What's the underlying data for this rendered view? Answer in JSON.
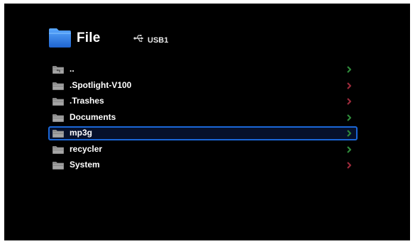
{
  "header": {
    "title": "File",
    "folder_icon": "folder-icon",
    "usb_icon": "usb-icon",
    "device_label": "USB1"
  },
  "colors": {
    "background": "#000000",
    "folder_blue": "#2f7fe6",
    "selection_border": "#1b67d8",
    "arrow_green": "#2f8a3a",
    "arrow_red": "#9a2a3a"
  },
  "files": [
    {
      "name": "..",
      "icon": "parent-folder-icon",
      "arrow_color": "green",
      "selected": false
    },
    {
      "name": ".Spotlight-V100",
      "icon": "folder-icon",
      "arrow_color": "red",
      "selected": false
    },
    {
      "name": ".Trashes",
      "icon": "folder-icon",
      "arrow_color": "red",
      "selected": false
    },
    {
      "name": "Documents",
      "icon": "folder-icon",
      "arrow_color": "green",
      "selected": false
    },
    {
      "name": "mp3g",
      "icon": "folder-icon",
      "arrow_color": "green",
      "selected": true
    },
    {
      "name": "recycler",
      "icon": "folder-icon",
      "arrow_color": "green",
      "selected": false
    },
    {
      "name": "System",
      "icon": "folder-icon",
      "arrow_color": "red",
      "selected": false
    }
  ]
}
